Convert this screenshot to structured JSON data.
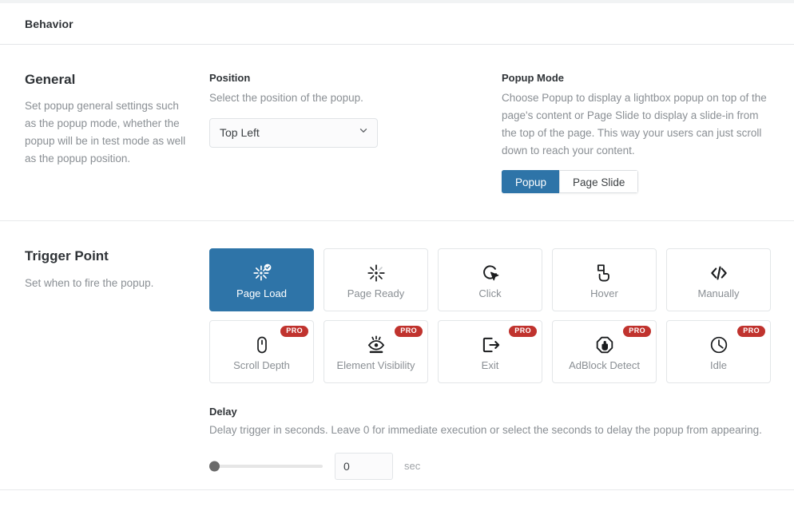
{
  "header": {
    "title": "Behavior"
  },
  "general": {
    "title": "General",
    "description": "Set popup general settings such as the popup mode, whether the popup will be in test mode as well as the popup position.",
    "position": {
      "label": "Position",
      "help": "Select the position of the popup.",
      "value": "Top Left",
      "chevron_icon": "chevron-down-icon"
    },
    "popup_mode": {
      "label": "Popup Mode",
      "help": "Choose Popup to display a lightbox popup on top of the page's content or Page Slide to display a slide-in from the top of the page. This way your users can just scroll down to reach your content.",
      "options": [
        {
          "label": "Popup",
          "selected": true
        },
        {
          "label": "Page Slide",
          "selected": false
        }
      ]
    }
  },
  "trigger_point": {
    "title": "Trigger Point",
    "description": "Set when to fire the popup.",
    "cards": [
      {
        "label": "Page Load",
        "icon": "page-load-icon",
        "selected": true,
        "pro": false
      },
      {
        "label": "Page Ready",
        "icon": "page-ready-icon",
        "selected": false,
        "pro": false
      },
      {
        "label": "Click",
        "icon": "click-icon",
        "selected": false,
        "pro": false
      },
      {
        "label": "Hover",
        "icon": "hover-icon",
        "selected": false,
        "pro": false
      },
      {
        "label": "Manually",
        "icon": "code-icon",
        "selected": false,
        "pro": false
      },
      {
        "label": "Scroll Depth",
        "icon": "mouse-icon",
        "selected": false,
        "pro": true
      },
      {
        "label": "Element Visibility",
        "icon": "eye-icon",
        "selected": false,
        "pro": true
      },
      {
        "label": "Exit",
        "icon": "exit-icon",
        "selected": false,
        "pro": true
      },
      {
        "label": "AdBlock Detect",
        "icon": "adblock-icon",
        "selected": false,
        "pro": true
      },
      {
        "label": "Idle",
        "icon": "clock-icon",
        "selected": false,
        "pro": true
      }
    ],
    "pro_badge_label": "PRO",
    "delay": {
      "label": "Delay",
      "help": "Delay trigger in seconds. Leave 0 for immediate execution or select the seconds to delay the popup from appearing.",
      "value": "0",
      "unit": "sec",
      "slider_position_percent": 0
    }
  },
  "colors": {
    "accent_blue": "#2e74a8",
    "pro_red": "#c0332e",
    "muted_text": "#8a8f94",
    "border": "#e3e6e8"
  }
}
